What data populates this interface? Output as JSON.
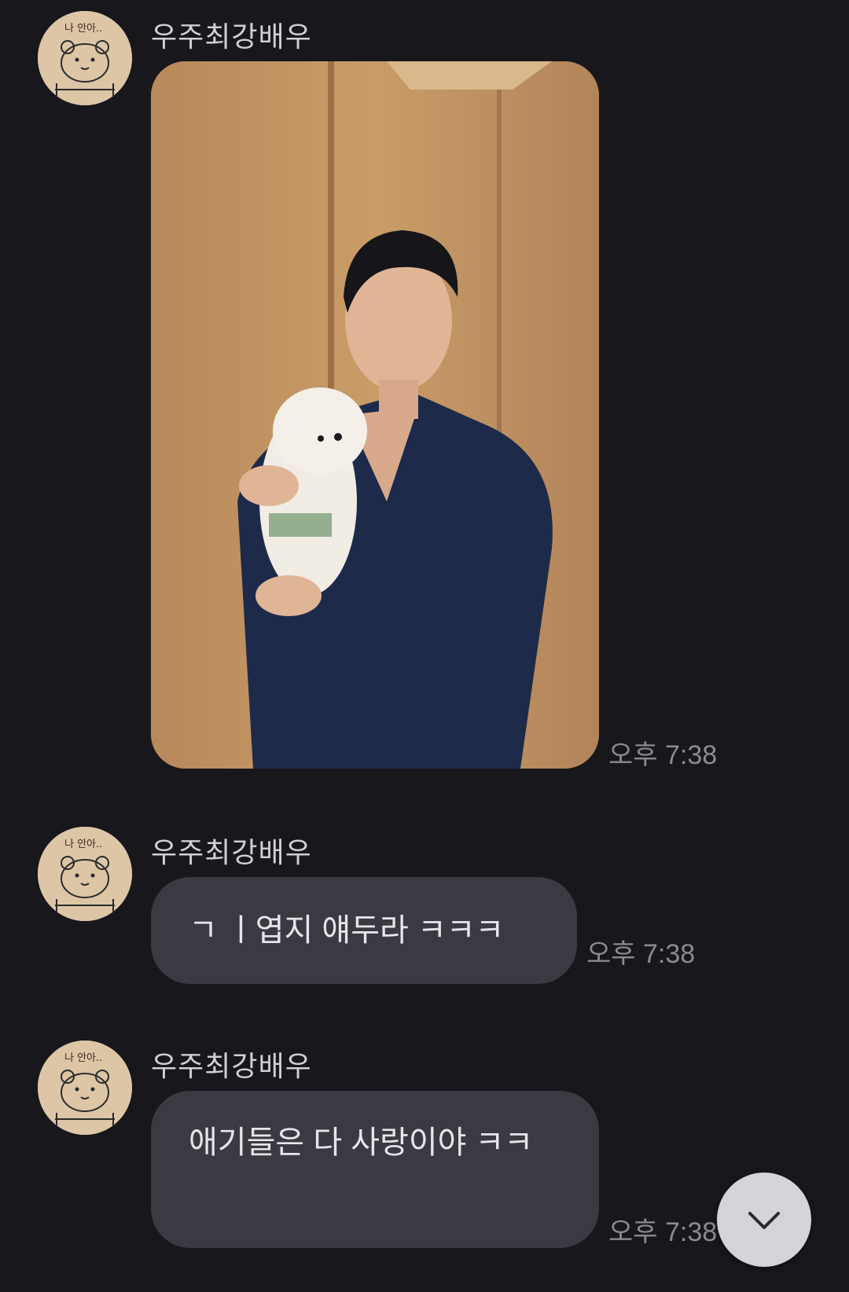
{
  "messages": [
    {
      "sender": "우주최강배우",
      "type": "photo",
      "time": "오후 7:38",
      "avatar_icon": "bear-drawing-avatar",
      "avatar_caption": "나 안아.."
    },
    {
      "sender": "우주최강배우",
      "type": "text",
      "text": "ㄱ ㅣ엽지 얘두라 ㅋㅋㅋ",
      "time": "오후 7:38",
      "avatar_icon": "bear-drawing-avatar",
      "avatar_caption": "나 안아.."
    },
    {
      "sender": "우주최강배우",
      "type": "text",
      "text": "애기들은 다 사랑이야 ㅋㅋ",
      "time": "오후 7:38",
      "avatar_icon": "bear-drawing-avatar",
      "avatar_caption": "나 안아.."
    }
  ],
  "scroll_button_icon": "chevron-down-icon",
  "colors": {
    "background": "#17171c",
    "bubble": "#393a42",
    "timestamp": "#8a8a90",
    "scroll_button": "#d4d4d8"
  }
}
